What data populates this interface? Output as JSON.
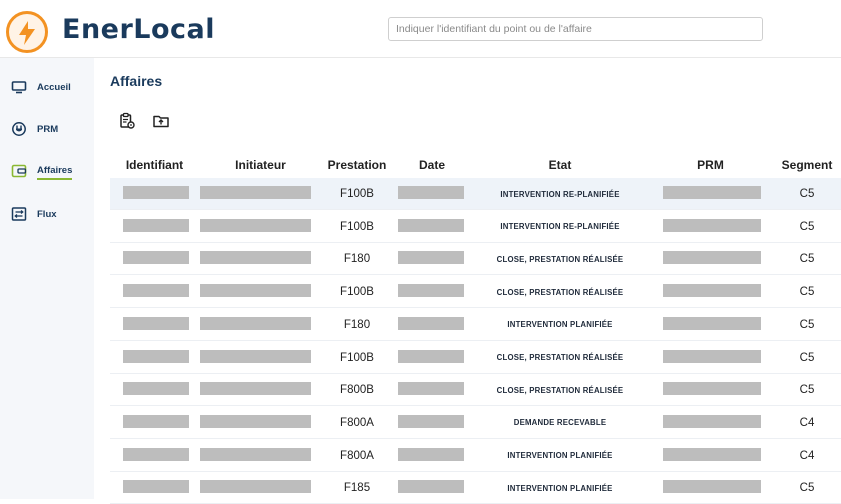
{
  "app": {
    "brand": "EnerLocal",
    "accent": "#f39222",
    "brand_color": "#1a3a5c"
  },
  "search": {
    "placeholder": "Indiquer l'identifiant du point ou de l'affaire",
    "value": ""
  },
  "sidebar": {
    "items": [
      {
        "label": "Accueil",
        "icon": "monitor-icon",
        "active": false
      },
      {
        "label": "PRM",
        "icon": "plug-icon",
        "active": false
      },
      {
        "label": "Affaires",
        "icon": "wallet-icon",
        "active": true
      },
      {
        "label": "Flux",
        "icon": "flux-icon",
        "active": false
      }
    ]
  },
  "page": {
    "title": "Affaires"
  },
  "toolbar": {
    "icons": [
      "clipboard-settings-icon",
      "folder-upload-icon"
    ]
  },
  "table": {
    "columns": [
      "Identifiant",
      "Initiateur",
      "Prestation",
      "Date",
      "Etat",
      "PRM",
      "Segment"
    ],
    "rows": [
      {
        "prestation": "F100B",
        "etat": "INTERVENTION RE-PLANIFIÉE",
        "segment": "C5"
      },
      {
        "prestation": "F100B",
        "etat": "INTERVENTION RE-PLANIFIÉE",
        "segment": "C5"
      },
      {
        "prestation": "F180",
        "etat": "CLOSE, PRESTATION RÉALISÉE",
        "segment": "C5"
      },
      {
        "prestation": "F100B",
        "etat": "CLOSE, PRESTATION RÉALISÉE",
        "segment": "C5"
      },
      {
        "prestation": "F180",
        "etat": "INTERVENTION PLANIFIÉE",
        "segment": "C5"
      },
      {
        "prestation": "F100B",
        "etat": "CLOSE, PRESTATION RÉALISÉE",
        "segment": "C5"
      },
      {
        "prestation": "F800B",
        "etat": "CLOSE, PRESTATION RÉALISÉE",
        "segment": "C5"
      },
      {
        "prestation": "F800A",
        "etat": "DEMANDE RECEVABLE",
        "segment": "C4"
      },
      {
        "prestation": "F800A",
        "etat": "INTERVENTION PLANIFIÉE",
        "segment": "C4"
      },
      {
        "prestation": "F185",
        "etat": "INTERVENTION PLANIFIÉE",
        "segment": "C5"
      }
    ]
  }
}
